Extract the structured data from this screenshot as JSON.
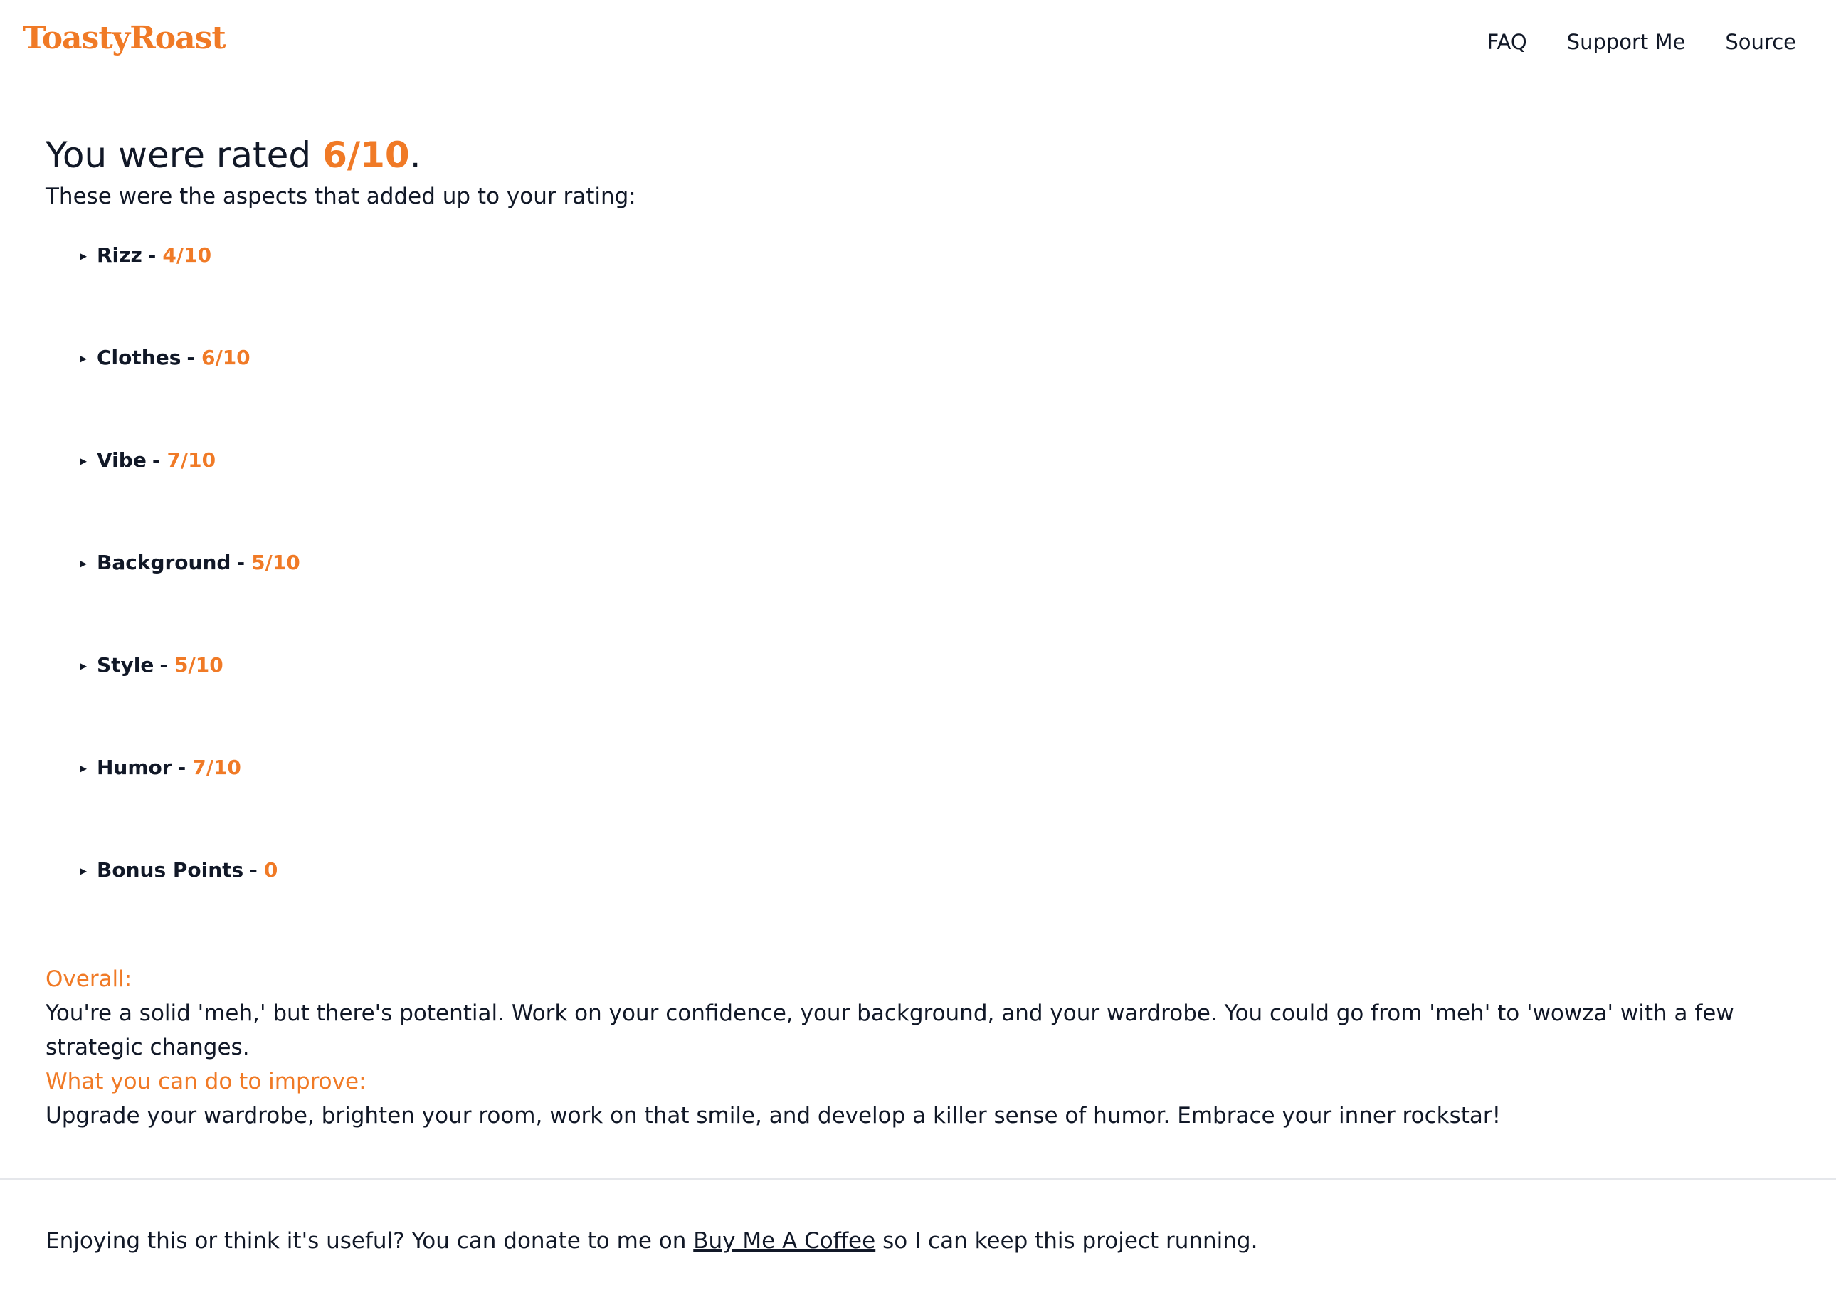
{
  "header": {
    "logo": "ToastyRoast",
    "nav": [
      {
        "label": "FAQ"
      },
      {
        "label": "Support Me"
      },
      {
        "label": "Source"
      }
    ]
  },
  "result": {
    "headline_prefix": "You were rated",
    "overall_score": "6/10",
    "headline_suffix": ".",
    "intro": "These were the aspects that added up to your rating:",
    "aspects": [
      {
        "name": "Rizz",
        "score": "4/10"
      },
      {
        "name": "Clothes",
        "score": "6/10"
      },
      {
        "name": "Vibe",
        "score": "7/10"
      },
      {
        "name": "Background",
        "score": "5/10"
      },
      {
        "name": "Style",
        "score": "5/10"
      },
      {
        "name": "Humor",
        "score": "7/10"
      },
      {
        "name": "Bonus Points",
        "score": "0"
      }
    ],
    "overall_title": "Overall:",
    "overall_text": "You're a solid 'meh,' but there's potential. Work on your confidence, your background, and your wardrobe. You could go from 'meh' to 'wowza' with a few strategic changes.",
    "improve_title": "What you can do to improve:",
    "improve_text": "Upgrade your wardrobe, brighten your room, work on that smile, and develop a killer sense of humor. Embrace your inner rockstar!"
  },
  "footer": {
    "text_before": "Enjoying this or think it's useful? You can donate to me on",
    "link_label": "Buy Me A Coffee",
    "text_after": "so I can keep this project running."
  },
  "colors": {
    "accent": "#f07a26",
    "text": "#111827"
  },
  "icons": {
    "aspect_toggle": "triangle-right-icon"
  }
}
